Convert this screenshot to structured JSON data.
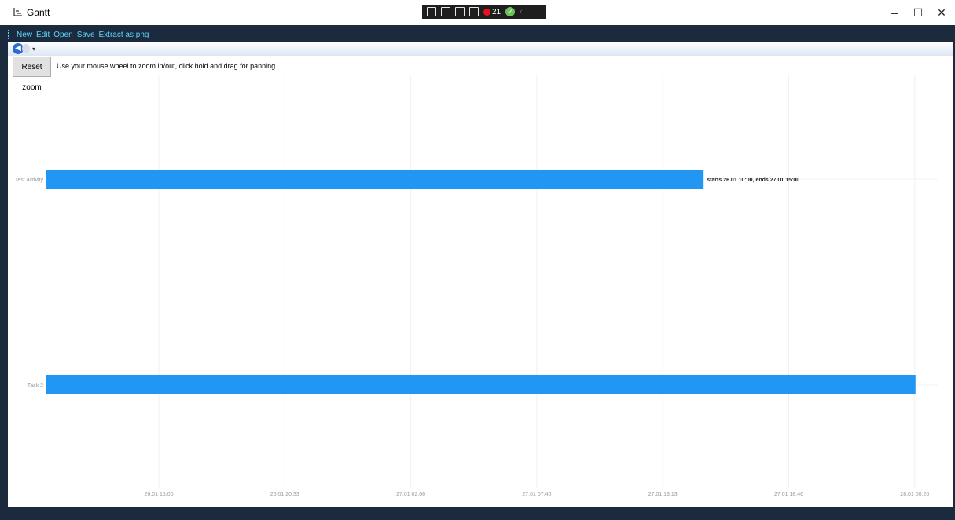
{
  "window": {
    "title": "Gantt",
    "controls": [
      "–",
      "☐",
      "✕"
    ]
  },
  "debug_toolbar": {
    "error_count": "21"
  },
  "menu": {
    "items": [
      "New",
      "Edit",
      "Open",
      "Save",
      "Extract as png"
    ]
  },
  "toolbar": {
    "reset_zoom_label": "Reset zoom",
    "hint": "Use your mouse wheel to zoom in/out, click hold and drag for panning"
  },
  "colors": {
    "bar": "#2196f3",
    "frame": "#1b2a3c",
    "menu_text": "#5dd5ff"
  },
  "chart_data": {
    "type": "bar",
    "orientation": "horizontal",
    "categories": [
      "Test activity",
      "Task 2"
    ],
    "tasks": [
      {
        "name": "Test activity",
        "start": "26.01 10:00",
        "end": "27.01 15:00",
        "label": "starts 26.01 10:00, ends 27.01 15:00"
      },
      {
        "name": "Task 2",
        "start": "26.01 10:00",
        "end": "28.01 00:20",
        "label": ""
      }
    ],
    "x_ticks": [
      "26.01 15:00",
      "26.01 20:33",
      "27.01 02:06",
      "27.01 07:40",
      "27.01 13:13",
      "27.01 18:46",
      "28.01 00:20"
    ],
    "grid": true
  }
}
